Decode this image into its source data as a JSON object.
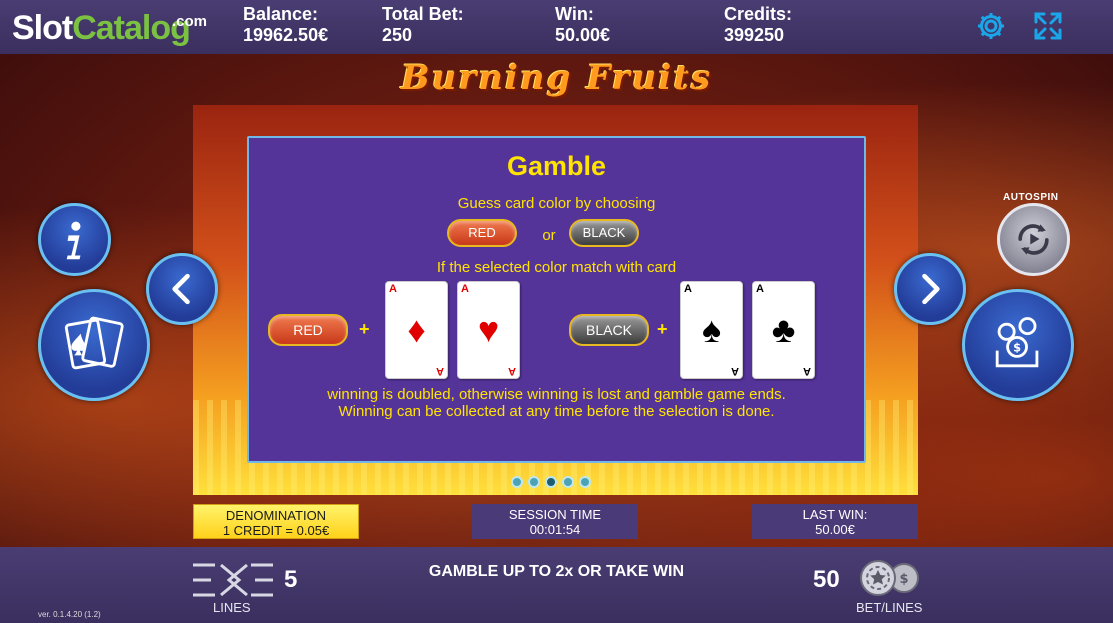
{
  "brand": {
    "slot": "Slot",
    "catalog": "Catalog",
    "com": ".com"
  },
  "topbar": {
    "balance_label": "Balance:",
    "balance_value": "19962.50€",
    "total_bet_label": "Total Bet:",
    "total_bet_value": "250",
    "win_label": "Win:",
    "win_value": "50.00€",
    "credits_label": "Credits:",
    "credits_value": "399250",
    "settings_icon": "gear-icon",
    "fullscreen_icon": "fullscreen-icon"
  },
  "game_title": "Burning Fruits",
  "gamble": {
    "title": "Gamble",
    "line1": "Guess card color by choosing",
    "red_label": "RED",
    "or_label": "or",
    "black_label": "BLACK",
    "line2": "If the selected color match with card",
    "example_red_label": "RED",
    "example_black_label": "BLACK",
    "plus": "+",
    "cards": [
      {
        "rank": "A",
        "suit": "♦",
        "color": "red"
      },
      {
        "rank": "A",
        "suit": "♥",
        "color": "red"
      },
      {
        "rank": "A",
        "suit": "♠",
        "color": "black"
      },
      {
        "rank": "A",
        "suit": "♣",
        "color": "black"
      }
    ],
    "line3": "winning is doubled, otherwise winning is lost and gamble game ends.",
    "line4": "Winning can be collected at any time before the selection is done."
  },
  "pager": {
    "count": 5,
    "active_index": 2
  },
  "side_buttons": {
    "info": "info-icon",
    "gamble_cards": "cards-icon",
    "prev": "chevron-left-icon",
    "next": "chevron-right-icon",
    "autospin_label": "AUTOSPIN",
    "autospin": "autospin-icon",
    "collect": "collect-coins-icon"
  },
  "info_boxes": {
    "denomination_title": "DENOMINATION",
    "denomination_value": "1 CREDIT = 0.05€",
    "session_title": "SESSION TIME",
    "session_value": "00:01:54",
    "last_win_title": "LAST WIN:",
    "last_win_value": "50.00€"
  },
  "bottombar": {
    "lines_value": "5",
    "lines_label": "LINES",
    "message": "GAMBLE UP TO 2x OR TAKE WIN",
    "bet_value": "50",
    "bet_label": "BET/LINES",
    "version": "ver. 0.1.4.20 (1.2)"
  },
  "colors": {
    "accent_yellow": "#ffe400",
    "panel_purple": "#55349a",
    "bar_purple": "#3a2f5e",
    "button_blue": "#233c98"
  }
}
